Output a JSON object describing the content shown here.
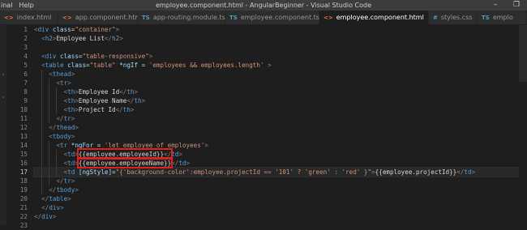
{
  "titlebar": {
    "menu": [
      "inal",
      "Help"
    ],
    "window_title": "employee.component.html - AngularBeginner - Visual Studio Code",
    "controls": [
      "–",
      "❐"
    ]
  },
  "tabs": [
    {
      "label": "index.html",
      "icon": "<>",
      "type": "html",
      "active": false
    },
    {
      "label": "app.component.html",
      "icon": "<>",
      "type": "html",
      "active": false
    },
    {
      "label": "app-routing.module.ts",
      "icon": "TS",
      "type": "ts",
      "active": false
    },
    {
      "label": "employee.component.ts",
      "icon": "TS",
      "type": "ts",
      "active": false
    },
    {
      "label": "employee.component.html",
      "icon": "<>",
      "type": "html",
      "active": true,
      "close": "×"
    },
    {
      "label": "styles.css",
      "icon": "#",
      "type": "css",
      "active": false
    },
    {
      "label": "emplo",
      "icon": "TS",
      "type": "ts",
      "active": false
    }
  ],
  "editor": {
    "current_line": 17,
    "lines": [
      {
        "n": "1",
        "tokens": [
          [
            "br",
            "<"
          ],
          [
            "tag",
            "div"
          ],
          [
            "txt",
            " "
          ],
          [
            "attr",
            "class"
          ],
          [
            "txt",
            "="
          ],
          [
            "str",
            "\"container\""
          ],
          [
            "br",
            ">"
          ]
        ]
      },
      {
        "n": "2",
        "tokens": [
          [
            "txt",
            "  "
          ],
          [
            "br",
            "<"
          ],
          [
            "tag",
            "h2"
          ],
          [
            "br",
            ">"
          ],
          [
            "txt",
            "Employee List"
          ],
          [
            "br",
            "</"
          ],
          [
            "tag",
            "h2"
          ],
          [
            "br",
            ">"
          ]
        ]
      },
      {
        "n": "3",
        "tokens": []
      },
      {
        "n": "4",
        "tokens": [
          [
            "txt",
            "  "
          ],
          [
            "br",
            "<"
          ],
          [
            "tag",
            "div"
          ],
          [
            "txt",
            " "
          ],
          [
            "attr",
            "class"
          ],
          [
            "txt",
            "="
          ],
          [
            "str",
            "\"table-responsive\""
          ],
          [
            "br",
            ">"
          ]
        ]
      },
      {
        "n": "5",
        "tokens": [
          [
            "txt",
            "  "
          ],
          [
            "br",
            "<"
          ],
          [
            "tag",
            "table"
          ],
          [
            "txt",
            " "
          ],
          [
            "attr",
            "class"
          ],
          [
            "txt",
            "="
          ],
          [
            "str",
            "\"table\""
          ],
          [
            "txt",
            " "
          ],
          [
            "attr",
            "*ngIf"
          ],
          [
            "txt",
            " = "
          ],
          [
            "str",
            "'employees && employees.length'"
          ],
          [
            "txt",
            " "
          ],
          [
            "br",
            ">"
          ]
        ]
      },
      {
        "n": "6",
        "tokens": [
          [
            "txt",
            "    "
          ],
          [
            "br",
            "<"
          ],
          [
            "tag",
            "thead"
          ],
          [
            "br",
            ">"
          ]
        ]
      },
      {
        "n": "7",
        "tokens": [
          [
            "txt",
            "      "
          ],
          [
            "br",
            "<"
          ],
          [
            "tag",
            "tr"
          ],
          [
            "br",
            ">"
          ]
        ]
      },
      {
        "n": "8",
        "tokens": [
          [
            "txt",
            "        "
          ],
          [
            "br",
            "<"
          ],
          [
            "tag",
            "th"
          ],
          [
            "br",
            ">"
          ],
          [
            "txt",
            "Employee Id"
          ],
          [
            "br",
            "</"
          ],
          [
            "tag",
            "th"
          ],
          [
            "br",
            ">"
          ]
        ]
      },
      {
        "n": "9",
        "tokens": [
          [
            "txt",
            "        "
          ],
          [
            "br",
            "<"
          ],
          [
            "tag",
            "th"
          ],
          [
            "br",
            ">"
          ],
          [
            "txt",
            "Employee Name"
          ],
          [
            "br",
            "</"
          ],
          [
            "tag",
            "th"
          ],
          [
            "br",
            ">"
          ]
        ]
      },
      {
        "n": "10",
        "tokens": [
          [
            "txt",
            "        "
          ],
          [
            "br",
            "<"
          ],
          [
            "tag",
            "th"
          ],
          [
            "br",
            ">"
          ],
          [
            "txt",
            "Project Id"
          ],
          [
            "br",
            "</"
          ],
          [
            "tag",
            "th"
          ],
          [
            "br",
            ">"
          ]
        ]
      },
      {
        "n": "11",
        "tokens": [
          [
            "txt",
            "      "
          ],
          [
            "br",
            "</"
          ],
          [
            "tag",
            "tr"
          ],
          [
            "br",
            ">"
          ]
        ]
      },
      {
        "n": "12",
        "tokens": [
          [
            "txt",
            "    "
          ],
          [
            "br",
            "</"
          ],
          [
            "tag",
            "thead"
          ],
          [
            "br",
            ">"
          ]
        ]
      },
      {
        "n": "13",
        "tokens": [
          [
            "txt",
            "    "
          ],
          [
            "br",
            "<"
          ],
          [
            "tag",
            "tbody"
          ],
          [
            "br",
            ">"
          ]
        ]
      },
      {
        "n": "14",
        "tokens": [
          [
            "txt",
            "      "
          ],
          [
            "br",
            "<"
          ],
          [
            "tag",
            "tr"
          ],
          [
            "txt",
            " "
          ],
          [
            "attr",
            "*ngFor"
          ],
          [
            "txt",
            " = "
          ],
          [
            "str",
            "'let employee of employees'"
          ],
          [
            "br",
            ">"
          ]
        ]
      },
      {
        "n": "15",
        "tokens": [
          [
            "txt",
            "        "
          ],
          [
            "br",
            "<"
          ],
          [
            "tag",
            "td"
          ],
          [
            "br",
            ">"
          ],
          [
            "txt",
            "{{employee.employeeId}}"
          ],
          [
            "br",
            "</"
          ],
          [
            "tag",
            "td"
          ],
          [
            "br",
            ">"
          ]
        ]
      },
      {
        "n": "16",
        "tokens": [
          [
            "txt",
            "        "
          ],
          [
            "br",
            "<"
          ],
          [
            "tag",
            "td"
          ],
          [
            "br",
            ">"
          ],
          [
            "txt",
            "{{employee.employeeName}}"
          ],
          [
            "br",
            "</"
          ],
          [
            "tag",
            "td"
          ],
          [
            "br",
            ">"
          ]
        ]
      },
      {
        "n": "17",
        "tokens": [
          [
            "txt",
            "        "
          ],
          [
            "br",
            "<"
          ],
          [
            "tag",
            "td"
          ],
          [
            "txt",
            " "
          ],
          [
            "attr",
            "[ngStyle]"
          ],
          [
            "txt",
            "="
          ],
          [
            "str",
            "\"{'background-color':employee.projectId == '101' ? 'green' : 'red' }\""
          ],
          [
            "br",
            ">"
          ],
          [
            "txt",
            "{{employee.projectId}}"
          ],
          [
            "br",
            "</"
          ],
          [
            "tag",
            "td"
          ],
          [
            "br",
            ">"
          ]
        ]
      },
      {
        "n": "18",
        "tokens": [
          [
            "txt",
            "      "
          ],
          [
            "br",
            "</"
          ],
          [
            "tag",
            "tr"
          ],
          [
            "br",
            ">"
          ]
        ]
      },
      {
        "n": "19",
        "tokens": [
          [
            "txt",
            "    "
          ],
          [
            "br",
            "</"
          ],
          [
            "tag",
            "tbody"
          ],
          [
            "br",
            ">"
          ]
        ]
      },
      {
        "n": "20",
        "tokens": [
          [
            "txt",
            "  "
          ],
          [
            "br",
            "</"
          ],
          [
            "tag",
            "table"
          ],
          [
            "br",
            ">"
          ]
        ]
      },
      {
        "n": "21",
        "tokens": [
          [
            "txt",
            "  "
          ],
          [
            "br",
            "</"
          ],
          [
            "tag",
            "div"
          ],
          [
            "br",
            ">"
          ]
        ]
      },
      {
        "n": "22",
        "tokens": [
          [
            "br",
            "</"
          ],
          [
            "tag",
            "div"
          ],
          [
            "br",
            ">"
          ]
        ]
      },
      {
        "n": "23",
        "tokens": []
      }
    ]
  },
  "colors": {
    "tag": "#569cd6",
    "bracket": "#808080",
    "attr": "#9cdcfe",
    "string": "#ce9178",
    "text": "#d4d4d4",
    "highlight_box": "#e01f1f"
  }
}
